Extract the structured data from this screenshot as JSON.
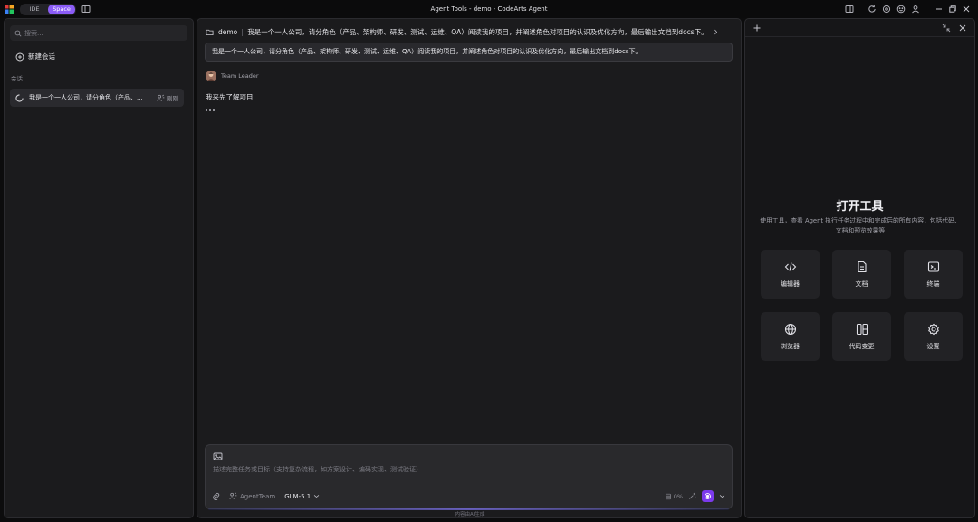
{
  "titlebar": {
    "title": "Agent Tools - demo - CodeArts Agent",
    "mode_tabs": [
      {
        "label": "IDE",
        "active": false
      },
      {
        "label": "Space",
        "active": true
      }
    ]
  },
  "sidebar": {
    "search_placeholder": "搜索...",
    "new_chat_label": "新建会话",
    "section_label": "会话",
    "sessions": [
      {
        "title": "我是一个一人公司，请分角色（产品、...",
        "action_label": "刚刚",
        "status": "running"
      }
    ]
  },
  "chat": {
    "breadcrumb": {
      "folder": "demo",
      "title": "我是一个一人公司，请分角色（产品、架构师、研发、测试、运维、QA）阅读我的项目，并阐述角色对项目的认识及优化方向，最后输出文档到docs下。"
    },
    "user_message": "我是一个一人公司，请分角色（产品、架构师、研发、测试、运维、QA）阅读我的项目，并阐述角色对项目的认识及优化方向，最后输出文档到docs下。",
    "agent": {
      "name": "Team Leader",
      "message": "我来先了解项目"
    },
    "composer": {
      "placeholder": "描述完整任务或目标（支持复杂流程，如方案设计、编码实现、测试验证）",
      "team_label": "AgentTeam",
      "model_label": "GLM-5.1",
      "token_usage": "0%"
    },
    "footer_note": "内容由AI生成"
  },
  "tools_panel": {
    "title": "打开工具",
    "description": "使用工具，查看 Agent 执行任务过程中和完成后的所有内容，包括代码、文档和预览效果等",
    "tools": [
      {
        "label": "编辑器",
        "icon": "code-icon"
      },
      {
        "label": "文档",
        "icon": "document-icon"
      },
      {
        "label": "终端",
        "icon": "terminal-icon"
      },
      {
        "label": "浏览器",
        "icon": "globe-icon"
      },
      {
        "label": "代码变更",
        "icon": "diff-icon"
      },
      {
        "label": "设置",
        "icon": "gear-icon"
      }
    ]
  },
  "colors": {
    "accent": "#8b5cf6",
    "send_button": "#7c3aed",
    "background": "#0c0c0d",
    "panel": "#1b1b1d"
  }
}
